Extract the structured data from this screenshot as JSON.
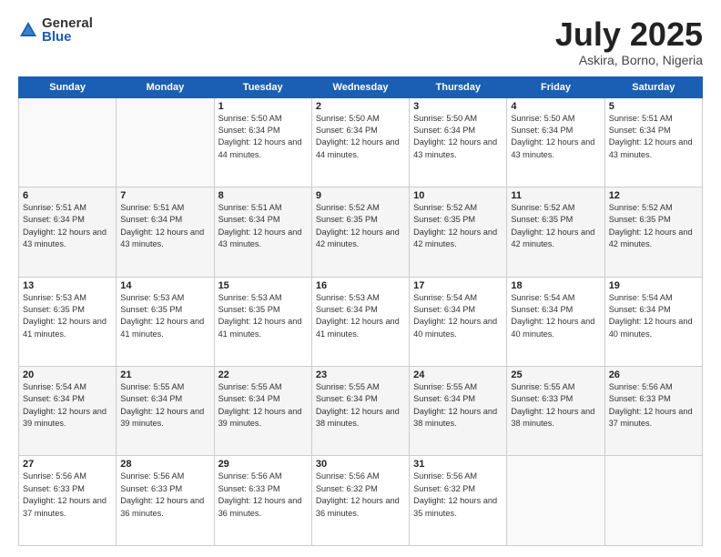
{
  "logo": {
    "general": "General",
    "blue": "Blue"
  },
  "title": "July 2025",
  "subtitle": "Askira, Borno, Nigeria",
  "days_header": [
    "Sunday",
    "Monday",
    "Tuesday",
    "Wednesday",
    "Thursday",
    "Friday",
    "Saturday"
  ],
  "weeks": [
    [
      {
        "day": "",
        "info": ""
      },
      {
        "day": "",
        "info": ""
      },
      {
        "day": "1",
        "sunrise": "Sunrise: 5:50 AM",
        "sunset": "Sunset: 6:34 PM",
        "daylight": "Daylight: 12 hours and 44 minutes."
      },
      {
        "day": "2",
        "sunrise": "Sunrise: 5:50 AM",
        "sunset": "Sunset: 6:34 PM",
        "daylight": "Daylight: 12 hours and 44 minutes."
      },
      {
        "day": "3",
        "sunrise": "Sunrise: 5:50 AM",
        "sunset": "Sunset: 6:34 PM",
        "daylight": "Daylight: 12 hours and 43 minutes."
      },
      {
        "day": "4",
        "sunrise": "Sunrise: 5:50 AM",
        "sunset": "Sunset: 6:34 PM",
        "daylight": "Daylight: 12 hours and 43 minutes."
      },
      {
        "day": "5",
        "sunrise": "Sunrise: 5:51 AM",
        "sunset": "Sunset: 6:34 PM",
        "daylight": "Daylight: 12 hours and 43 minutes."
      }
    ],
    [
      {
        "day": "6",
        "sunrise": "Sunrise: 5:51 AM",
        "sunset": "Sunset: 6:34 PM",
        "daylight": "Daylight: 12 hours and 43 minutes."
      },
      {
        "day": "7",
        "sunrise": "Sunrise: 5:51 AM",
        "sunset": "Sunset: 6:34 PM",
        "daylight": "Daylight: 12 hours and 43 minutes."
      },
      {
        "day": "8",
        "sunrise": "Sunrise: 5:51 AM",
        "sunset": "Sunset: 6:34 PM",
        "daylight": "Daylight: 12 hours and 43 minutes."
      },
      {
        "day": "9",
        "sunrise": "Sunrise: 5:52 AM",
        "sunset": "Sunset: 6:35 PM",
        "daylight": "Daylight: 12 hours and 42 minutes."
      },
      {
        "day": "10",
        "sunrise": "Sunrise: 5:52 AM",
        "sunset": "Sunset: 6:35 PM",
        "daylight": "Daylight: 12 hours and 42 minutes."
      },
      {
        "day": "11",
        "sunrise": "Sunrise: 5:52 AM",
        "sunset": "Sunset: 6:35 PM",
        "daylight": "Daylight: 12 hours and 42 minutes."
      },
      {
        "day": "12",
        "sunrise": "Sunrise: 5:52 AM",
        "sunset": "Sunset: 6:35 PM",
        "daylight": "Daylight: 12 hours and 42 minutes."
      }
    ],
    [
      {
        "day": "13",
        "sunrise": "Sunrise: 5:53 AM",
        "sunset": "Sunset: 6:35 PM",
        "daylight": "Daylight: 12 hours and 41 minutes."
      },
      {
        "day": "14",
        "sunrise": "Sunrise: 5:53 AM",
        "sunset": "Sunset: 6:35 PM",
        "daylight": "Daylight: 12 hours and 41 minutes."
      },
      {
        "day": "15",
        "sunrise": "Sunrise: 5:53 AM",
        "sunset": "Sunset: 6:35 PM",
        "daylight": "Daylight: 12 hours and 41 minutes."
      },
      {
        "day": "16",
        "sunrise": "Sunrise: 5:53 AM",
        "sunset": "Sunset: 6:34 PM",
        "daylight": "Daylight: 12 hours and 41 minutes."
      },
      {
        "day": "17",
        "sunrise": "Sunrise: 5:54 AM",
        "sunset": "Sunset: 6:34 PM",
        "daylight": "Daylight: 12 hours and 40 minutes."
      },
      {
        "day": "18",
        "sunrise": "Sunrise: 5:54 AM",
        "sunset": "Sunset: 6:34 PM",
        "daylight": "Daylight: 12 hours and 40 minutes."
      },
      {
        "day": "19",
        "sunrise": "Sunrise: 5:54 AM",
        "sunset": "Sunset: 6:34 PM",
        "daylight": "Daylight: 12 hours and 40 minutes."
      }
    ],
    [
      {
        "day": "20",
        "sunrise": "Sunrise: 5:54 AM",
        "sunset": "Sunset: 6:34 PM",
        "daylight": "Daylight: 12 hours and 39 minutes."
      },
      {
        "day": "21",
        "sunrise": "Sunrise: 5:55 AM",
        "sunset": "Sunset: 6:34 PM",
        "daylight": "Daylight: 12 hours and 39 minutes."
      },
      {
        "day": "22",
        "sunrise": "Sunrise: 5:55 AM",
        "sunset": "Sunset: 6:34 PM",
        "daylight": "Daylight: 12 hours and 39 minutes."
      },
      {
        "day": "23",
        "sunrise": "Sunrise: 5:55 AM",
        "sunset": "Sunset: 6:34 PM",
        "daylight": "Daylight: 12 hours and 38 minutes."
      },
      {
        "day": "24",
        "sunrise": "Sunrise: 5:55 AM",
        "sunset": "Sunset: 6:34 PM",
        "daylight": "Daylight: 12 hours and 38 minutes."
      },
      {
        "day": "25",
        "sunrise": "Sunrise: 5:55 AM",
        "sunset": "Sunset: 6:33 PM",
        "daylight": "Daylight: 12 hours and 38 minutes."
      },
      {
        "day": "26",
        "sunrise": "Sunrise: 5:56 AM",
        "sunset": "Sunset: 6:33 PM",
        "daylight": "Daylight: 12 hours and 37 minutes."
      }
    ],
    [
      {
        "day": "27",
        "sunrise": "Sunrise: 5:56 AM",
        "sunset": "Sunset: 6:33 PM",
        "daylight": "Daylight: 12 hours and 37 minutes."
      },
      {
        "day": "28",
        "sunrise": "Sunrise: 5:56 AM",
        "sunset": "Sunset: 6:33 PM",
        "daylight": "Daylight: 12 hours and 36 minutes."
      },
      {
        "day": "29",
        "sunrise": "Sunrise: 5:56 AM",
        "sunset": "Sunset: 6:33 PM",
        "daylight": "Daylight: 12 hours and 36 minutes."
      },
      {
        "day": "30",
        "sunrise": "Sunrise: 5:56 AM",
        "sunset": "Sunset: 6:32 PM",
        "daylight": "Daylight: 12 hours and 36 minutes."
      },
      {
        "day": "31",
        "sunrise": "Sunrise: 5:56 AM",
        "sunset": "Sunset: 6:32 PM",
        "daylight": "Daylight: 12 hours and 35 minutes."
      },
      {
        "day": "",
        "info": ""
      },
      {
        "day": "",
        "info": ""
      }
    ]
  ]
}
